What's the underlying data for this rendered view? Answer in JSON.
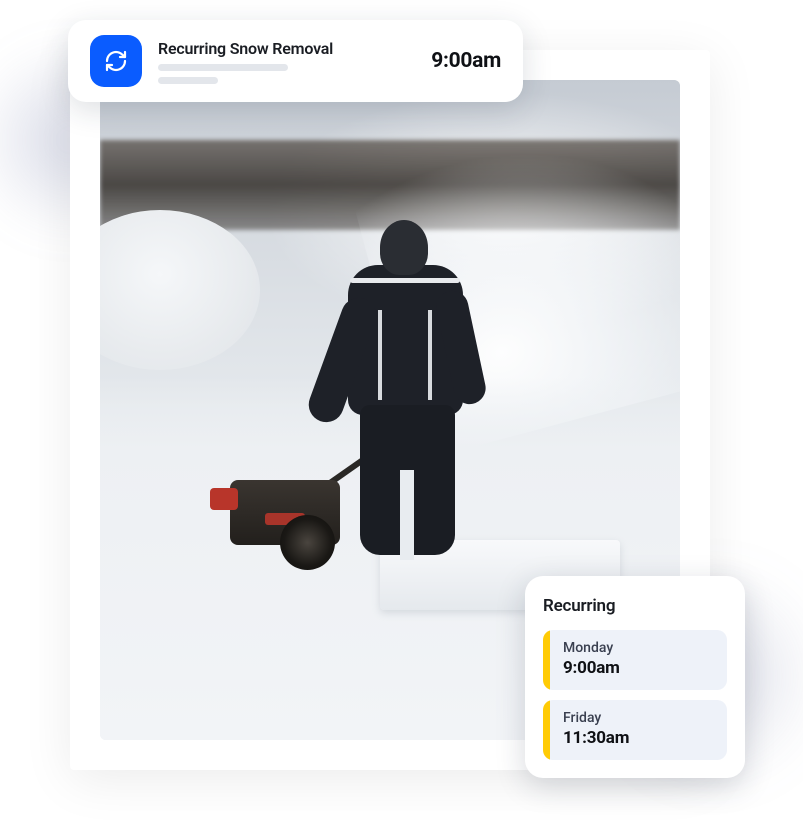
{
  "notification": {
    "title": "Recurring Snow Removal",
    "time": "9:00am",
    "icon_name": "refresh-icon"
  },
  "schedule": {
    "title": "Recurring",
    "items": [
      {
        "day": "Monday",
        "time": "9:00am"
      },
      {
        "day": "Friday",
        "time": "11:30am"
      }
    ]
  },
  "colors": {
    "accent_blue": "#0a5cff",
    "accent_yellow": "#ffcb05"
  }
}
